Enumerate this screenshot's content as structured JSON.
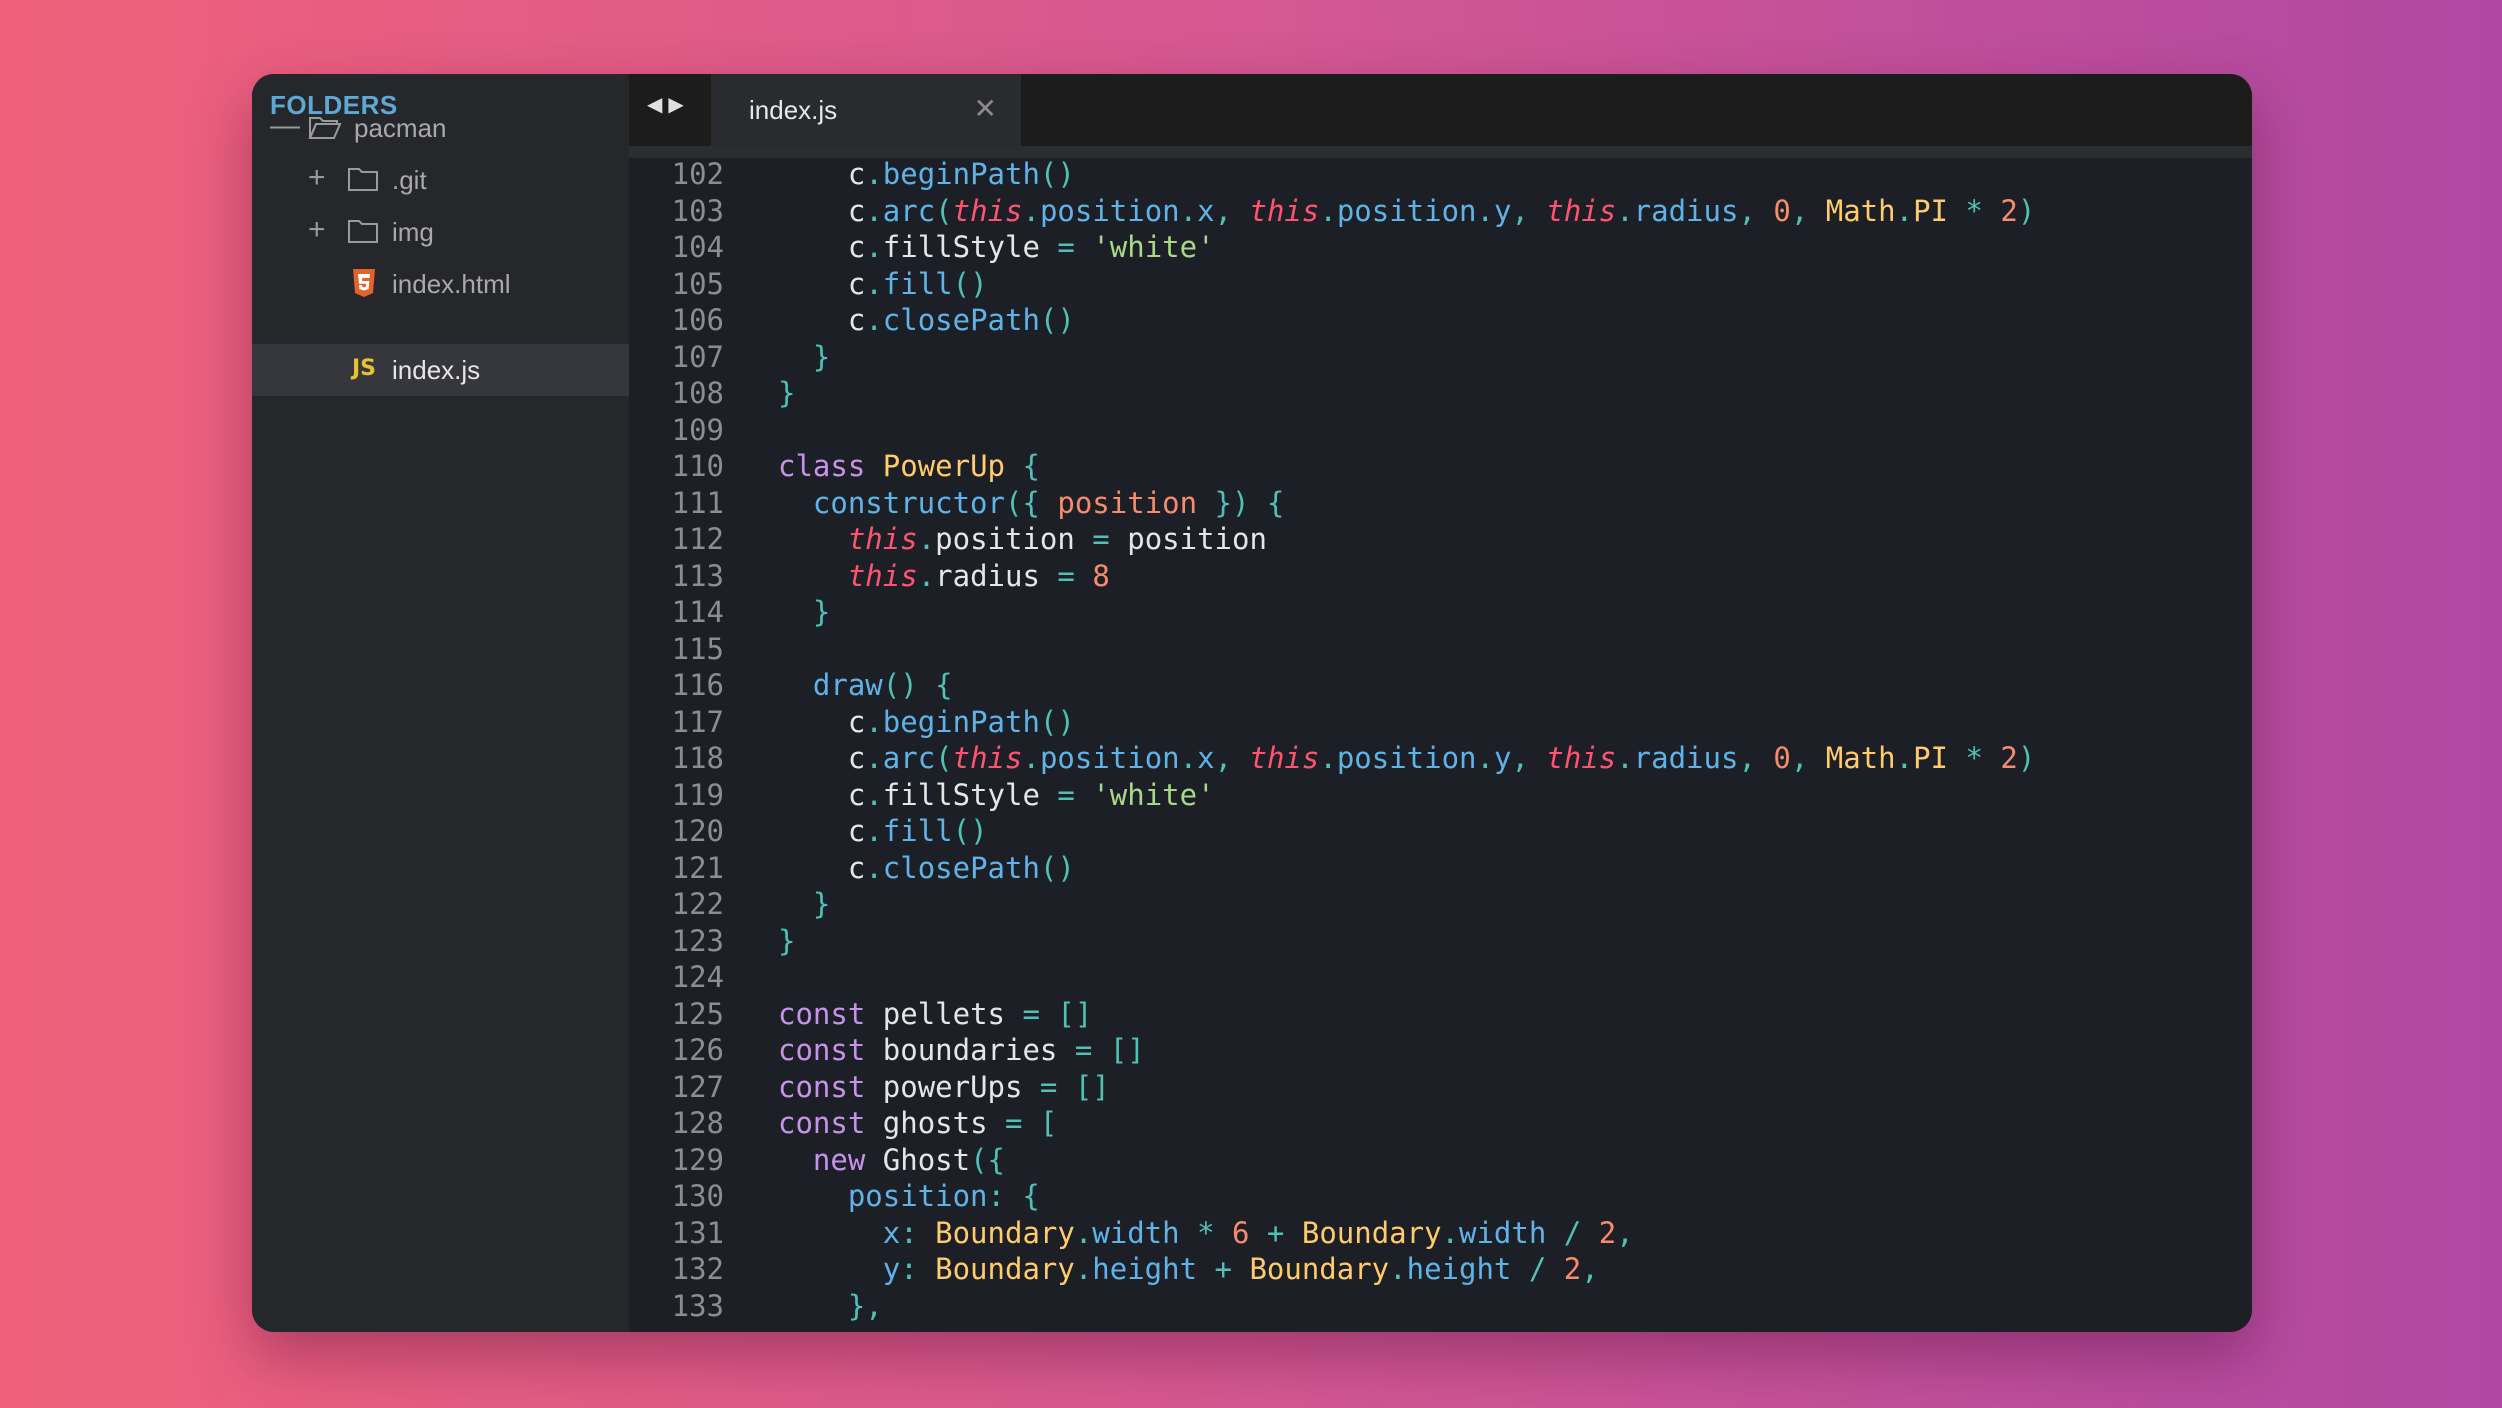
{
  "sidebar": {
    "title": "FOLDERS",
    "items": [
      {
        "label": "pacman",
        "toggle": "—",
        "kind": "folder-open"
      },
      {
        "label": ".git",
        "toggle": "+",
        "kind": "folder"
      },
      {
        "label": "img",
        "toggle": "+",
        "kind": "folder"
      },
      {
        "label": "index.html",
        "kind": "html"
      },
      {
        "label": "index.js",
        "kind": "js",
        "icon_text": "JS",
        "selected": true
      }
    ]
  },
  "tabbar": {
    "nav_back": "◀",
    "nav_forward": "▶",
    "active_tab": "index.js",
    "close_glyph": "✕"
  },
  "colors": {
    "keyword": "#c792ea",
    "this": "#ff5370",
    "function": "#5fb3e8",
    "punctuation": "#4fc1b5",
    "number": "#f78c6c",
    "string": "#a8d98a",
    "class": "#ffcb6b",
    "folders_title": "#5fa8d3",
    "js_icon": "#e6c230",
    "html_icon": "#e5622c"
  },
  "code": [
    {
      "n": "102",
      "t": [
        [
          "p",
          "    c"
        ],
        [
          "u",
          "."
        ],
        [
          "f",
          "beginPath"
        ],
        [
          "u",
          "()"
        ]
      ]
    },
    {
      "n": "103",
      "t": [
        [
          "p",
          "    c"
        ],
        [
          "u",
          "."
        ],
        [
          "f",
          "arc"
        ],
        [
          "u",
          "("
        ],
        [
          "th",
          "this"
        ],
        [
          "u",
          "."
        ],
        [
          "f",
          "position"
        ],
        [
          "u",
          "."
        ],
        [
          "f",
          "x"
        ],
        [
          "u",
          ", "
        ],
        [
          "th",
          "this"
        ],
        [
          "u",
          "."
        ],
        [
          "f",
          "position"
        ],
        [
          "u",
          "."
        ],
        [
          "f",
          "y"
        ],
        [
          "u",
          ", "
        ],
        [
          "th",
          "this"
        ],
        [
          "u",
          "."
        ],
        [
          "f",
          "radius"
        ],
        [
          "u",
          ", "
        ],
        [
          "n",
          "0"
        ],
        [
          "u",
          ", "
        ],
        [
          "c",
          "Math"
        ],
        [
          "u",
          "."
        ],
        [
          "c",
          "PI"
        ],
        [
          "u",
          " "
        ],
        [
          "u",
          "*"
        ],
        [
          "u",
          " "
        ],
        [
          "n",
          "2"
        ],
        [
          "u",
          ")"
        ]
      ]
    },
    {
      "n": "104",
      "t": [
        [
          "p",
          "    c"
        ],
        [
          "u",
          "."
        ],
        [
          "p",
          "fillStyle"
        ],
        [
          "u",
          " = "
        ],
        [
          "s",
          "'white'"
        ]
      ]
    },
    {
      "n": "105",
      "t": [
        [
          "p",
          "    c"
        ],
        [
          "u",
          "."
        ],
        [
          "f",
          "fill"
        ],
        [
          "u",
          "()"
        ]
      ]
    },
    {
      "n": "106",
      "t": [
        [
          "p",
          "    c"
        ],
        [
          "u",
          "."
        ],
        [
          "f",
          "closePath"
        ],
        [
          "u",
          "()"
        ]
      ]
    },
    {
      "n": "107",
      "t": [
        [
          "u",
          "  }"
        ]
      ]
    },
    {
      "n": "108",
      "t": [
        [
          "u",
          "}"
        ]
      ]
    },
    {
      "n": "109",
      "t": []
    },
    {
      "n": "110",
      "t": [
        [
          "k",
          "class"
        ],
        [
          "p",
          " "
        ],
        [
          "c",
          "PowerUp"
        ],
        [
          "u",
          " {"
        ]
      ]
    },
    {
      "n": "111",
      "t": [
        [
          "f",
          "  constructor"
        ],
        [
          "u",
          "({ "
        ],
        [
          "n",
          "position"
        ],
        [
          "u",
          " }) {"
        ]
      ]
    },
    {
      "n": "112",
      "t": [
        [
          "th",
          "    this"
        ],
        [
          "u",
          "."
        ],
        [
          "p",
          "position"
        ],
        [
          "u",
          " = "
        ],
        [
          "p",
          "position"
        ]
      ]
    },
    {
      "n": "113",
      "t": [
        [
          "th",
          "    this"
        ],
        [
          "u",
          "."
        ],
        [
          "p",
          "radius"
        ],
        [
          "u",
          " = "
        ],
        [
          "n",
          "8"
        ]
      ]
    },
    {
      "n": "114",
      "t": [
        [
          "u",
          "  }"
        ]
      ]
    },
    {
      "n": "115",
      "t": []
    },
    {
      "n": "116",
      "t": [
        [
          "f",
          "  draw"
        ],
        [
          "u",
          "() {"
        ]
      ]
    },
    {
      "n": "117",
      "t": [
        [
          "p",
          "    c"
        ],
        [
          "u",
          "."
        ],
        [
          "f",
          "beginPath"
        ],
        [
          "u",
          "()"
        ]
      ]
    },
    {
      "n": "118",
      "t": [
        [
          "p",
          "    c"
        ],
        [
          "u",
          "."
        ],
        [
          "f",
          "arc"
        ],
        [
          "u",
          "("
        ],
        [
          "th",
          "this"
        ],
        [
          "u",
          "."
        ],
        [
          "f",
          "position"
        ],
        [
          "u",
          "."
        ],
        [
          "f",
          "x"
        ],
        [
          "u",
          ", "
        ],
        [
          "th",
          "this"
        ],
        [
          "u",
          "."
        ],
        [
          "f",
          "position"
        ],
        [
          "u",
          "."
        ],
        [
          "f",
          "y"
        ],
        [
          "u",
          ", "
        ],
        [
          "th",
          "this"
        ],
        [
          "u",
          "."
        ],
        [
          "f",
          "radius"
        ],
        [
          "u",
          ", "
        ],
        [
          "n",
          "0"
        ],
        [
          "u",
          ", "
        ],
        [
          "c",
          "Math"
        ],
        [
          "u",
          "."
        ],
        [
          "c",
          "PI"
        ],
        [
          "u",
          " "
        ],
        [
          "u",
          "*"
        ],
        [
          "u",
          " "
        ],
        [
          "n",
          "2"
        ],
        [
          "u",
          ")"
        ]
      ]
    },
    {
      "n": "119",
      "t": [
        [
          "p",
          "    c"
        ],
        [
          "u",
          "."
        ],
        [
          "p",
          "fillStyle"
        ],
        [
          "u",
          " = "
        ],
        [
          "s",
          "'white'"
        ]
      ]
    },
    {
      "n": "120",
      "t": [
        [
          "p",
          "    c"
        ],
        [
          "u",
          "."
        ],
        [
          "f",
          "fill"
        ],
        [
          "u",
          "()"
        ]
      ]
    },
    {
      "n": "121",
      "t": [
        [
          "p",
          "    c"
        ],
        [
          "u",
          "."
        ],
        [
          "f",
          "closePath"
        ],
        [
          "u",
          "()"
        ]
      ]
    },
    {
      "n": "122",
      "t": [
        [
          "u",
          "  }"
        ]
      ]
    },
    {
      "n": "123",
      "t": [
        [
          "u",
          "}"
        ]
      ]
    },
    {
      "n": "124",
      "t": []
    },
    {
      "n": "125",
      "t": [
        [
          "k",
          "const"
        ],
        [
          "p",
          " pellets"
        ],
        [
          "u",
          " = []"
        ]
      ]
    },
    {
      "n": "126",
      "t": [
        [
          "k",
          "const"
        ],
        [
          "p",
          " boundaries"
        ],
        [
          "u",
          " = []"
        ]
      ]
    },
    {
      "n": "127",
      "t": [
        [
          "k",
          "const"
        ],
        [
          "p",
          " powerUps"
        ],
        [
          "u",
          " = []"
        ]
      ]
    },
    {
      "n": "128",
      "t": [
        [
          "k",
          "const"
        ],
        [
          "p",
          " ghosts"
        ],
        [
          "u",
          " = ["
        ]
      ]
    },
    {
      "n": "129",
      "t": [
        [
          "k",
          "  new"
        ],
        [
          "p",
          " Ghost"
        ],
        [
          "u",
          "({"
        ]
      ]
    },
    {
      "n": "130",
      "t": [
        [
          "f",
          "    position"
        ],
        [
          "u",
          ": {"
        ]
      ]
    },
    {
      "n": "131",
      "t": [
        [
          "f",
          "      x"
        ],
        [
          "u",
          ": "
        ],
        [
          "c",
          "Boundary"
        ],
        [
          "u",
          "."
        ],
        [
          "f",
          "width"
        ],
        [
          "u",
          " * "
        ],
        [
          "n",
          "6"
        ],
        [
          "u",
          " + "
        ],
        [
          "c",
          "Boundary"
        ],
        [
          "u",
          "."
        ],
        [
          "f",
          "width"
        ],
        [
          "u",
          " / "
        ],
        [
          "n",
          "2"
        ],
        [
          "u",
          ","
        ]
      ]
    },
    {
      "n": "132",
      "t": [
        [
          "f",
          "      y"
        ],
        [
          "u",
          ": "
        ],
        [
          "c",
          "Boundary"
        ],
        [
          "u",
          "."
        ],
        [
          "f",
          "height"
        ],
        [
          "u",
          " + "
        ],
        [
          "c",
          "Boundary"
        ],
        [
          "u",
          "."
        ],
        [
          "f",
          "height"
        ],
        [
          "u",
          " / "
        ],
        [
          "n",
          "2"
        ],
        [
          "u",
          ","
        ]
      ]
    },
    {
      "n": "133",
      "t": [
        [
          "u",
          "    },"
        ]
      ]
    }
  ]
}
